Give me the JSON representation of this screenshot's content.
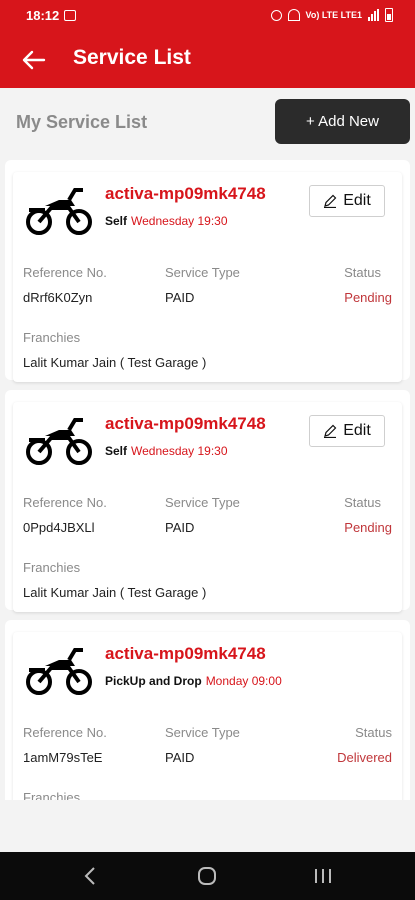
{
  "status_bar": {
    "time": "18:12",
    "network": "Vo) LTE LTE1"
  },
  "app_bar": {
    "title": "Service List"
  },
  "header": {
    "heading": "My Service List",
    "add_button": "+ Add New"
  },
  "labels": {
    "reference": "Reference No.",
    "service_type": "Service Type",
    "status": "Status",
    "franchise": "Franchies",
    "edit": "Edit"
  },
  "services": [
    {
      "vehicle": "activa-mp09mk4748",
      "mode": "Self",
      "schedule": "Wednesday 19:30",
      "reference": "dRrf6K0Zyn",
      "service_type": "PAID",
      "status": "Pending",
      "franchise": "Lalit Kumar Jain ( Test Garage )",
      "editable": true
    },
    {
      "vehicle": "activa-mp09mk4748",
      "mode": "Self",
      "schedule": "Wednesday 19:30",
      "reference": "0Ppd4JBXLl",
      "service_type": "PAID",
      "status": "Pending",
      "franchise": "Lalit Kumar Jain ( Test Garage )",
      "editable": true
    },
    {
      "vehicle": "activa-mp09mk4748",
      "mode": "PickUp and Drop",
      "schedule": "Monday 09:00",
      "reference": "1amM79sTeE",
      "service_type": "PAID",
      "status": "Delivered",
      "franchise": "",
      "editable": false
    }
  ],
  "colors": {
    "brand": "#d7151b",
    "dark_button": "#2b2b2b"
  },
  "icons": [
    "back-arrow-icon",
    "motorcycle-icon",
    "pencil-icon",
    "nav-back-icon",
    "nav-home-icon",
    "nav-recents-icon"
  ]
}
